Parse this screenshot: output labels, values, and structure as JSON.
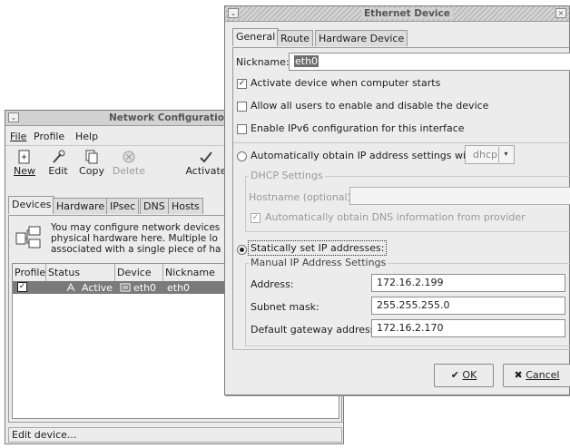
{
  "network_window": {
    "title": "Network Configuration",
    "menu": {
      "file": "File",
      "profile": "Profile",
      "help": "Help"
    },
    "toolbar": {
      "new": "New",
      "edit": "Edit",
      "copy": "Copy",
      "delete": "Delete",
      "activate": "Activate"
    },
    "tabs": [
      "Devices",
      "Hardware",
      "IPsec",
      "DNS",
      "Hosts"
    ],
    "info_lines": [
      "You may configure network devices",
      "physical hardware here.  Multiple lo",
      "associated with a single piece of ha"
    ],
    "columns": [
      "Profile",
      "Status",
      "Device",
      "Nickname"
    ],
    "row": {
      "status": "Active",
      "device": "eth0",
      "nickname": "eth0"
    },
    "statusbar": "Edit device..."
  },
  "ethernet_dialog": {
    "title": "Ethernet Device",
    "tabs": [
      "General",
      "Route",
      "Hardware Device"
    ],
    "nickname_label": "Nickname:",
    "nickname_value": "eth0",
    "check_activate": "Activate device when computer starts",
    "check_allow_users": "Allow all users to enable and disable the device",
    "check_ipv6": "Enable IPv6 configuration for this interface",
    "radio_auto": "Automatically obtain IP address settings with:",
    "dhcp_value": "dhcp",
    "dhcp_group": "DHCP Settings",
    "hostname_label": "Hostname (optional):",
    "hostname_value": "",
    "auto_dns": "Automatically obtain DNS information from provider",
    "radio_static": "Statically set IP addresses:",
    "manual_group": "Manual IP Address Settings",
    "address_label": "Address:",
    "address_value": "172.16.2.199",
    "subnet_label": "Subnet mask:",
    "subnet_value": "255.255.255.0",
    "gateway_label": "Default gateway address:",
    "gateway_value": "172.16.2.170",
    "ok": "OK",
    "cancel": "Cancel"
  }
}
